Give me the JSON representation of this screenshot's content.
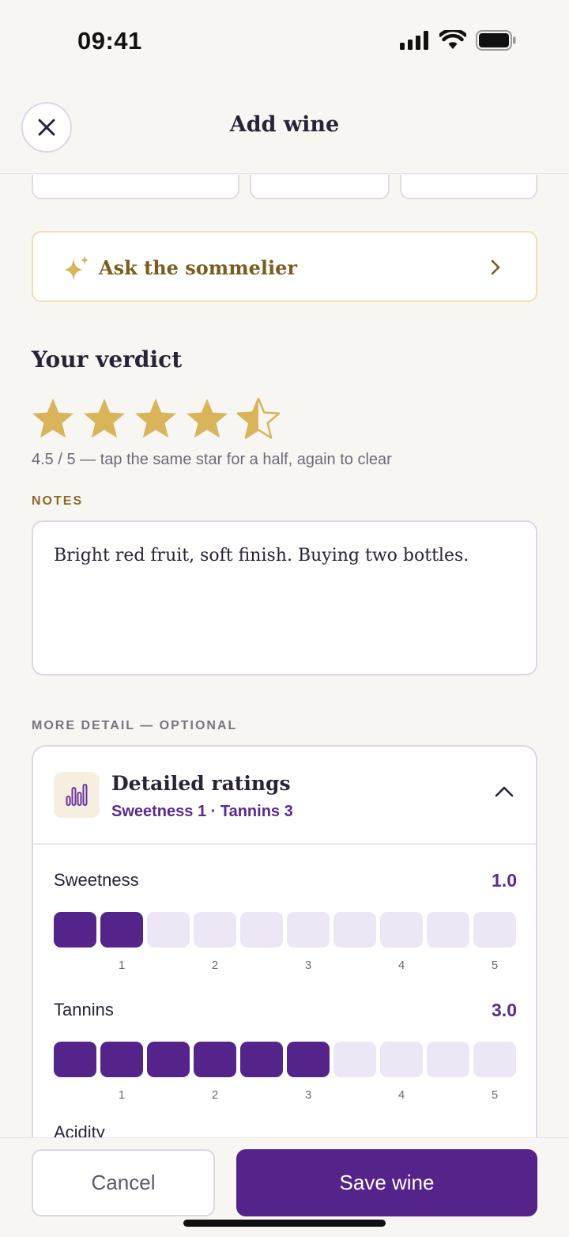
{
  "status_bar": {
    "time": "09:41"
  },
  "header": {
    "title": "Add wine"
  },
  "sommelier": {
    "label": "Ask the sommelier"
  },
  "verdict": {
    "title": "Your verdict",
    "rating": 4.5,
    "max": 5,
    "hint": "4.5 / 5 — tap the same star for a half, again to clear"
  },
  "notes": {
    "label": "NOTES",
    "value": "Bright red fruit, soft finish. Buying two bottles."
  },
  "more_detail": {
    "label": "MORE DETAIL — OPTIONAL"
  },
  "detailed_ratings": {
    "title": "Detailed ratings",
    "summary": "Sweetness 1 · Tannins 3",
    "metrics": [
      {
        "name": "Sweetness",
        "value_text": "1.0",
        "value": 1.0,
        "ticks": [
          "1",
          "2",
          "3",
          "4",
          "5"
        ]
      },
      {
        "name": "Tannins",
        "value_text": "3.0",
        "value": 3.0,
        "ticks": [
          "1",
          "2",
          "3",
          "4",
          "5"
        ]
      }
    ],
    "next_metric": "Acidity"
  },
  "actions": {
    "cancel": "Cancel",
    "save": "Save wine"
  },
  "colors": {
    "accent": "#55248a",
    "gold": "#d9b45a",
    "background": "#f8f6f3"
  }
}
